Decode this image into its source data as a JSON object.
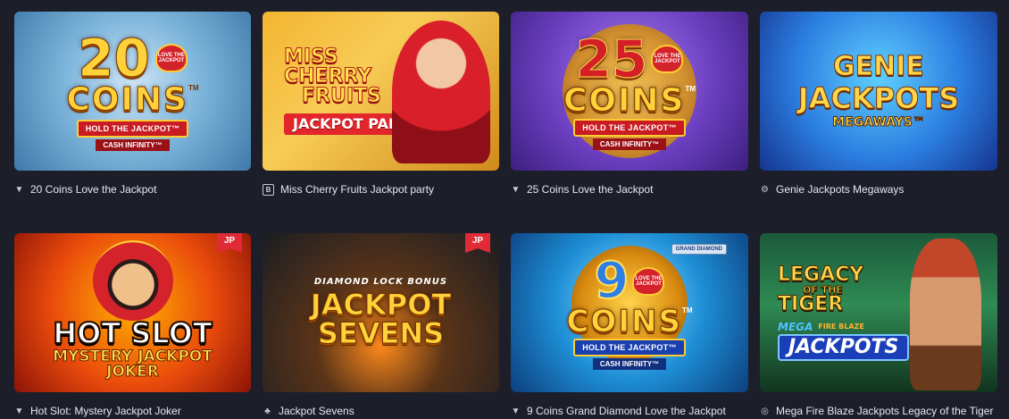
{
  "games": [
    {
      "title": "20 Coins Love the Jackpot",
      "provider_icon": "triangle-down-icon",
      "art": {
        "number": "20",
        "word": "COINS",
        "tm": "TM",
        "heart": "LOVE THE JACKPOT",
        "line1": "HOLD THE JACKPOT™",
        "line2": "CASH INFINITY™"
      }
    },
    {
      "title": "Miss Cherry Fruits Jackpot party",
      "provider_icon": "b-square-icon",
      "art": {
        "line1": "MISS",
        "line2": "CHERRY",
        "line3": "FRUITS",
        "line4": "JACKPOT PARTY"
      }
    },
    {
      "title": "25 Coins Love the Jackpot",
      "provider_icon": "triangle-down-icon",
      "art": {
        "number": "25",
        "word": "COINS",
        "tm": "TM",
        "heart": "LOVE THE JACKPOT",
        "line1": "HOLD THE JACKPOT™",
        "line2": "CASH INFINITY™"
      }
    },
    {
      "title": "Genie Jackpots Megaways",
      "provider_icon": "gear-icon",
      "art": {
        "line1": "GENIE",
        "line2": "JACKPOTS",
        "line3": "MEGAWAYS™"
      }
    },
    {
      "title": "Hot Slot: Mystery Jackpot Joker",
      "provider_icon": "triangle-down-icon",
      "badge": "JP",
      "art": {
        "line1": "HOT SLOT",
        "line2": "MYSTERY JACKPOT",
        "line3": "JOKER"
      }
    },
    {
      "title": "Jackpot Sevens",
      "provider_icon": "clubs-icon",
      "badge": "JP",
      "art": {
        "line1": "DIAMOND LOCK BONUS",
        "line2": "JACKPOT",
        "line3": "SEVENS"
      }
    },
    {
      "title": "9 Coins Grand Diamond Love the Jackpot",
      "provider_icon": "triangle-down-icon",
      "art": {
        "number": "9",
        "word": "COINS",
        "tm": "TM",
        "heart": "LOVE THE JACKPOT",
        "line1": "HOLD THE JACKPOT™",
        "line2": "CASH INFINITY™",
        "badge": "GRAND DIAMOND"
      }
    },
    {
      "title": "Mega Fire Blaze Jackpots Legacy of the Tiger",
      "provider_icon": "eye-swoosh-icon",
      "art": {
        "line1": "LEGACY",
        "line2": "OF THE",
        "line3": "TIGER",
        "line4": "MEGA",
        "line5": "FIRE BLAZE",
        "line6": "JACKPOTS"
      }
    }
  ]
}
